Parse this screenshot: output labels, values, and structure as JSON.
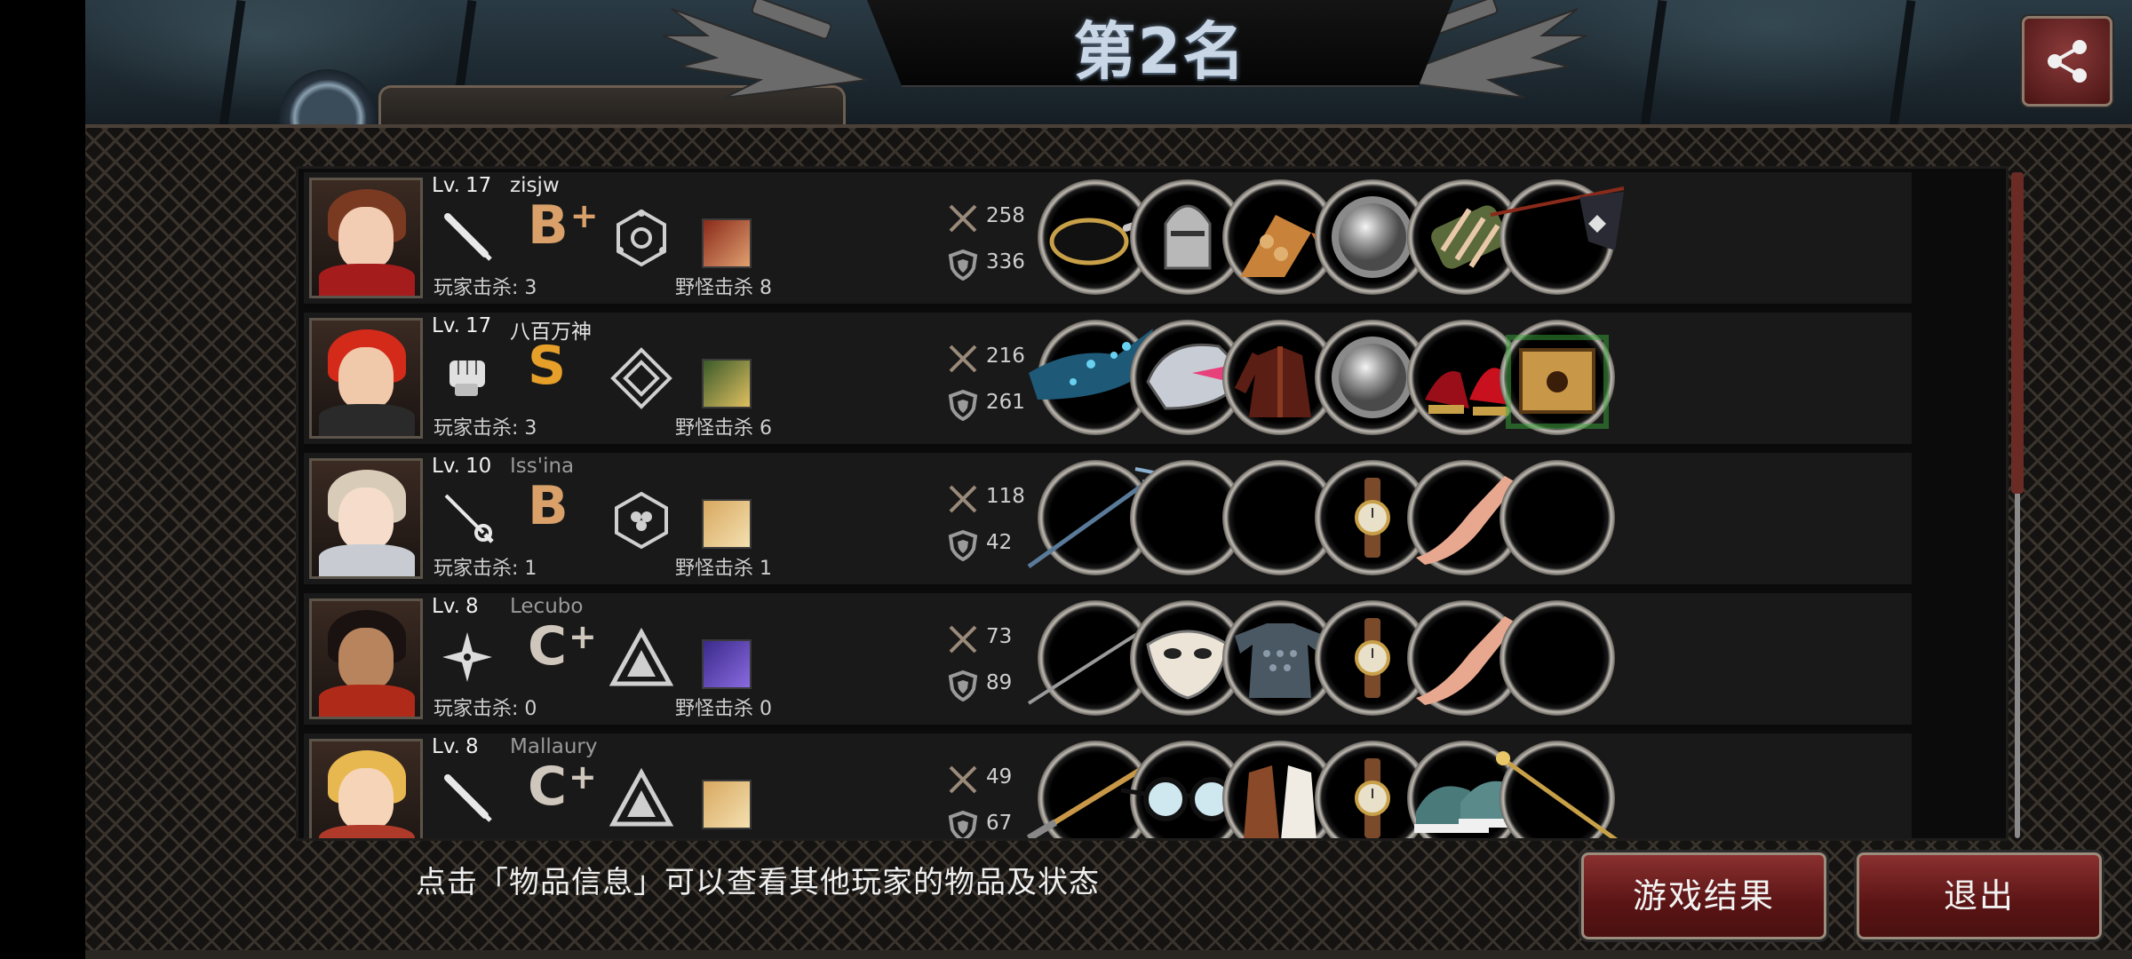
{
  "header": {
    "title": "第2名",
    "share_icon": "share-icon"
  },
  "players": [
    {
      "level_prefix": "Lv.",
      "level": "17",
      "name": "zisjw",
      "name_dim": false,
      "weapon_icon": "baseball-bat-icon",
      "grade": "B",
      "grade_plus": "+",
      "grade_color": "#d9a06a",
      "rank_icon": "hexagon-rank-icon",
      "monster_colors": [
        "#8a2a1a",
        "#e0a070"
      ],
      "player_kills": "玩家击杀: 3",
      "monster_kills": "野怪击杀 8",
      "attack": "258",
      "defense": "336",
      "hair": "#7a3a22",
      "skin": "#f2cdb4",
      "body": "#a51c1c",
      "equipment": [
        "frying-pan",
        "knight-helmet",
        "chest-armor-scales",
        "steel-disc",
        "bound-arm-guard",
        "flag-spear"
      ]
    },
    {
      "level_prefix": "Lv.",
      "level": "17",
      "name": "八百万神",
      "name_dim": false,
      "weapon_icon": "fist-icon",
      "grade": "S",
      "grade_plus": "",
      "grade_color": "#e6a02a",
      "rank_icon": "diamond-rank-icon",
      "monster_colors": [
        "#3a5a2a",
        "#e0c060"
      ],
      "player_kills": "玩家击杀: 3",
      "monster_kills": "野怪击杀 6",
      "attack": "216",
      "defense": "261",
      "hair": "#d42a1a",
      "skin": "#f0c8aa",
      "body": "#2a2a2a",
      "equipment": [
        "water-gauntlet",
        "mecha-helmet",
        "leather-jacket",
        "steel-disc",
        "red-high-heels",
        "cursed-box"
      ]
    },
    {
      "level_prefix": "Lv.",
      "level": "10",
      "name": "Iss'ina",
      "name_dim": true,
      "weapon_icon": "rapier-icon",
      "grade": "B",
      "grade_plus": "",
      "grade_color": "#d9a06a",
      "rank_icon": "triple-circle-rank-icon",
      "monster_colors": [
        "#d8a860",
        "#f4e0b0"
      ],
      "player_kills": "玩家击杀: 1",
      "monster_kills": "野怪击杀 1",
      "attack": "118",
      "defense": "42",
      "hair": "#d8ccb8",
      "skin": "#f6dccb",
      "body": "#c8ccd2",
      "equipment": [
        "trident",
        "",
        "",
        "wristwatch",
        "stocking-leg",
        ""
      ]
    },
    {
      "level_prefix": "Lv.",
      "level": "8",
      "name": "Lecubo",
      "name_dim": true,
      "weapon_icon": "shuriken-icon",
      "grade": "C",
      "grade_plus": "+",
      "grade_color": "#cfc6bc",
      "rank_icon": "triangle-rank-icon",
      "monster_colors": [
        "#3a2a8a",
        "#8a6ae0"
      ],
      "player_kills": "玩家击杀: 0",
      "monster_kills": "野怪击杀 0",
      "attack": "73",
      "defense": "89",
      "hair": "#1a1210",
      "skin": "#b8845e",
      "body": "#b02a1a",
      "equipment": [
        "spear",
        "white-mask",
        "chainmail",
        "wristwatch",
        "stocking-leg",
        ""
      ]
    },
    {
      "level_prefix": "Lv.",
      "level": "8",
      "name": "Mallaury",
      "name_dim": true,
      "weapon_icon": "baseball-bat-icon",
      "grade": "C",
      "grade_plus": "+",
      "grade_color": "#cfc6bc",
      "rank_icon": "triangle-rank-icon",
      "monster_colors": [
        "#d8a860",
        "#f4e0b0"
      ],
      "player_kills": "",
      "monster_kills": "",
      "attack": "49",
      "defense": "67",
      "hair": "#e8b850",
      "skin": "#f6d4b8",
      "body": "#b03a2a",
      "equipment": [
        "staff",
        "glasses",
        "brown-vest",
        "wristwatch",
        "sneakers",
        "golden-scepter"
      ]
    }
  ],
  "footer": {
    "tip": "点击「物品信息」可以查看其他玩家的物品及状态",
    "result_button": "游戏结果",
    "exit_button": "退出"
  },
  "colors": {
    "accent_button": "#6b1e1e",
    "panel_bg": "#191919"
  }
}
